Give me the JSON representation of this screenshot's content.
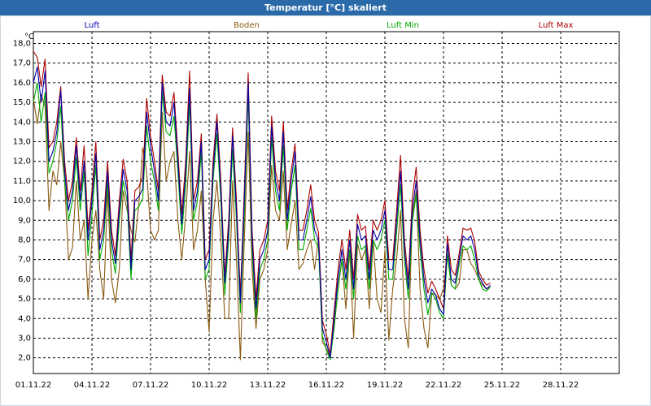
{
  "window": {
    "title": "Temperatur [°C] skaliert"
  },
  "chart_data": {
    "type": "line",
    "title": "Temperatur [°C] skaliert",
    "ylabel": "°C",
    "xlabel": "",
    "ylim": [
      1.2,
      18.6
    ],
    "y_ticks": [
      2.0,
      3.0,
      4.0,
      5.0,
      6.0,
      7.0,
      8.0,
      9.0,
      10.0,
      11.0,
      12.0,
      13.0,
      14.0,
      15.0,
      16.0,
      17.0,
      18.0
    ],
    "y_tick_labels": [
      "2,0",
      "3,0",
      "4,0",
      "5,0",
      "6,0",
      "7,0",
      "8,0",
      "9,0",
      "10,0",
      "11,0",
      "12,0",
      "13,0",
      "14,0",
      "15,0",
      "16,0",
      "17,0",
      "18,0"
    ],
    "xlim": [
      1,
      31
    ],
    "x_ticks": [
      1,
      4,
      7,
      10,
      13,
      16,
      19,
      22,
      25,
      28
    ],
    "x_tick_labels": [
      "01.11.22",
      "04.11.22",
      "07.11.22",
      "10.11.22",
      "13.11.22",
      "16.11.22",
      "19.11.22",
      "22.11.22",
      "25.11.22",
      "28.11.22"
    ],
    "grid": true,
    "legend_position": "top",
    "colors": {
      "Luft": "#0000aa",
      "Boden": "#8b5a10",
      "Luft Min": "#00aa00",
      "Luft Max": "#aa0000",
      "title_bar": "#2a6aa8"
    },
    "x": [
      1.0,
      1.2,
      1.4,
      1.6,
      1.8,
      2.0,
      2.2,
      2.4,
      2.6,
      2.8,
      3.0,
      3.2,
      3.4,
      3.6,
      3.8,
      4.0,
      4.2,
      4.4,
      4.6,
      4.8,
      5.0,
      5.2,
      5.4,
      5.6,
      5.8,
      6.0,
      6.2,
      6.4,
      6.6,
      6.8,
      7.0,
      7.2,
      7.4,
      7.6,
      7.8,
      8.0,
      8.2,
      8.4,
      8.6,
      8.8,
      9.0,
      9.2,
      9.4,
      9.6,
      9.8,
      10.0,
      10.2,
      10.4,
      10.6,
      10.8,
      11.0,
      11.2,
      11.4,
      11.6,
      11.8,
      12.0,
      12.2,
      12.4,
      12.6,
      12.8,
      13.0,
      13.2,
      13.4,
      13.6,
      13.8,
      14.0,
      14.2,
      14.4,
      14.6,
      14.8,
      15.0,
      15.2,
      15.4,
      15.6,
      15.8,
      16.0,
      16.2,
      16.4,
      16.6,
      16.8,
      17.0,
      17.2,
      17.4,
      17.6,
      17.8,
      18.0,
      18.2,
      18.4,
      18.6,
      18.8,
      19.0,
      19.2,
      19.4,
      19.6,
      19.8,
      20.0,
      20.2,
      20.4,
      20.6,
      20.8,
      21.0,
      21.2,
      21.4,
      21.6,
      21.8,
      22.0,
      22.2,
      22.4,
      22.6,
      22.8,
      23.0,
      23.2,
      23.4,
      23.6,
      23.8,
      24.0,
      24.2,
      24.4,
      24.6,
      24.8,
      25.0,
      25.2,
      25.4,
      25.6,
      25.8,
      26.0,
      26.2,
      26.4,
      26.6,
      26.8,
      27.0,
      27.2,
      27.4,
      27.6,
      27.8,
      28.0,
      28.2,
      28.4,
      28.6,
      28.8,
      29.0,
      29.2,
      29.4,
      29.6,
      29.8,
      30.0,
      30.2,
      30.4,
      30.6,
      30.8,
      31.0
    ],
    "series": [
      {
        "name": "Luft",
        "values": [
          16.0,
          16.8,
          15.0,
          16.6,
          12.0,
          12.5,
          13.5,
          15.6,
          11.5,
          9.5,
          10.5,
          12.8,
          10.0,
          12.0,
          8.0,
          10.0,
          12.4,
          7.5,
          8.5,
          11.5,
          8.0,
          6.8,
          9.5,
          11.6,
          10.5,
          6.5,
          10.0,
          10.2,
          10.6,
          14.5,
          12.8,
          11.5,
          10.0,
          16.0,
          14.0,
          13.8,
          15.0,
          12.0,
          8.8,
          11.5,
          15.7,
          9.5,
          10.5,
          13.0,
          6.5,
          7.0,
          11.5,
          14.0,
          10.5,
          5.8,
          8.5,
          13.3,
          9.5,
          4.8,
          10.0,
          16.0,
          8.0,
          4.5,
          7.0,
          7.5,
          8.5,
          13.8,
          11.0,
          10.0,
          13.5,
          9.0,
          11.0,
          12.5,
          8.0,
          8.0,
          9.0,
          10.2,
          8.5,
          8.0,
          3.5,
          2.8,
          2.0,
          4.0,
          6.0,
          7.5,
          6.0,
          8.0,
          5.5,
          8.8,
          8.0,
          8.2,
          6.0,
          8.5,
          8.0,
          8.5,
          9.5,
          6.5,
          6.5,
          9.0,
          11.5,
          7.5,
          5.5,
          9.5,
          11.0,
          8.0,
          6.0,
          4.8,
          5.5,
          5.2,
          4.5,
          4.2,
          7.8,
          6.0,
          5.8,
          7.0,
          8.2,
          8.0,
          8.2,
          7.5,
          6.2,
          5.8,
          5.5,
          5.7
        ]
      },
      {
        "name": "Boden",
        "values": [
          15.2,
          13.9,
          15.4,
          14.8,
          9.5,
          11.5,
          10.8,
          13.0,
          11.0,
          7.0,
          7.6,
          11.0,
          8.0,
          9.0,
          5.0,
          8.0,
          9.5,
          6.5,
          5.0,
          10.5,
          6.0,
          4.8,
          6.5,
          10.5,
          9.5,
          8.5,
          7.9,
          9.8,
          12.7,
          11.5,
          8.5,
          8.0,
          8.5,
          14.5,
          11.0,
          12.0,
          12.5,
          9.0,
          7.0,
          9.3,
          12.5,
          7.5,
          8.5,
          10.5,
          6.0,
          3.3,
          9.0,
          11.0,
          8.0,
          4.0,
          4.0,
          11.0,
          7.0,
          1.9,
          8.0,
          13.5,
          6.5,
          3.5,
          6.0,
          6.5,
          7.5,
          11.8,
          9.5,
          9.0,
          11.5,
          7.5,
          8.8,
          10.0,
          6.5,
          6.8,
          7.5,
          8.0,
          6.5,
          8.1,
          2.8,
          2.5,
          2.0,
          3.5,
          5.5,
          7.0,
          4.5,
          7.5,
          3.0,
          7.8,
          7.0,
          7.5,
          4.5,
          8.0,
          5.0,
          4.3,
          7.5,
          2.9,
          5.5,
          7.0,
          9.5,
          4.0,
          2.5,
          9.2,
          10.5,
          5.5,
          3.5,
          2.5,
          5.3,
          5.2,
          5.0,
          5.5,
          7.2,
          5.7,
          5.5,
          5.8,
          7.5,
          7.5,
          6.8,
          6.5,
          6.0,
          5.7,
          5.5,
          5.6
        ]
      },
      {
        "name": "Luft Min",
        "values": [
          15.0,
          16.0,
          14.0,
          15.5,
          11.4,
          12.0,
          13.0,
          14.8,
          11.0,
          9.0,
          10.0,
          12.2,
          9.5,
          11.5,
          7.2,
          9.3,
          11.8,
          7.0,
          8.0,
          11.0,
          7.5,
          6.3,
          9.0,
          11.0,
          10.0,
          6.0,
          9.5,
          9.7,
          10.1,
          13.8,
          12.0,
          11.0,
          9.5,
          15.5,
          13.5,
          13.3,
          14.3,
          11.5,
          8.3,
          10.8,
          15.0,
          9.0,
          10.0,
          12.5,
          6.0,
          6.5,
          11.0,
          13.4,
          10.0,
          5.2,
          8.0,
          12.6,
          9.0,
          4.3,
          9.3,
          15.4,
          7.5,
          4.0,
          6.5,
          7.0,
          8.0,
          13.2,
          10.5,
          9.5,
          12.8,
          8.5,
          10.5,
          11.8,
          7.5,
          7.5,
          8.5,
          9.6,
          8.0,
          7.6,
          3.1,
          2.4,
          1.9,
          3.6,
          5.5,
          7.0,
          5.5,
          7.5,
          5.0,
          8.2,
          7.5,
          7.7,
          5.5,
          8.0,
          7.5,
          8.0,
          9.0,
          6.0,
          6.0,
          8.4,
          10.8,
          7.0,
          5.0,
          8.9,
          10.3,
          7.5,
          5.5,
          4.2,
          5.3,
          5.0,
          4.3,
          4.0,
          7.3,
          5.7,
          5.5,
          6.7,
          7.7,
          7.5,
          7.7,
          7.0,
          6.0,
          5.5,
          5.4,
          5.6
        ]
      },
      {
        "name": "Luft Max",
        "values": [
          17.6,
          17.3,
          15.8,
          17.2,
          12.7,
          13.0,
          14.0,
          15.8,
          12.0,
          10.0,
          11.0,
          13.2,
          10.5,
          12.8,
          8.5,
          10.5,
          13.0,
          8.0,
          9.0,
          12.0,
          8.5,
          7.2,
          10.0,
          12.1,
          11.0,
          7.0,
          10.5,
          10.7,
          11.2,
          15.2,
          13.3,
          12.0,
          10.5,
          16.4,
          14.5,
          14.3,
          15.5,
          12.5,
          9.3,
          12.0,
          16.6,
          10.0,
          11.0,
          13.4,
          7.0,
          7.5,
          12.0,
          14.4,
          11.0,
          6.2,
          9.0,
          13.7,
          10.0,
          5.2,
          10.5,
          16.5,
          8.5,
          5.0,
          7.5,
          8.0,
          9.0,
          14.3,
          11.5,
          10.5,
          14.0,
          9.5,
          11.5,
          12.9,
          8.5,
          8.5,
          9.5,
          10.8,
          9.0,
          8.4,
          3.9,
          3.2,
          2.2,
          4.4,
          6.5,
          8.0,
          6.5,
          8.5,
          6.0,
          9.3,
          8.5,
          8.7,
          6.5,
          9.0,
          8.5,
          9.0,
          10.0,
          7.0,
          7.0,
          9.5,
          12.3,
          8.0,
          6.0,
          10.1,
          11.7,
          8.5,
          6.5,
          5.3,
          5.9,
          5.5,
          5.0,
          4.5,
          8.2,
          6.5,
          6.2,
          7.3,
          8.6,
          8.5,
          8.6,
          7.9,
          6.4,
          6.0,
          5.7,
          5.8
        ]
      }
    ]
  }
}
